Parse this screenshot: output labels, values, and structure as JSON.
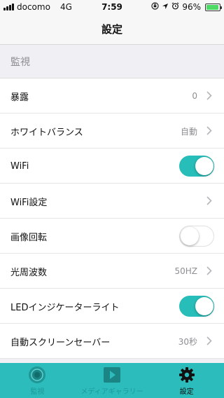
{
  "status_bar": {
    "carrier": "docomo",
    "network": "4G",
    "time": "7:59",
    "battery_percent": "96%",
    "battery_level": 0.96,
    "icons": [
      "signal-icon",
      "lock-rotation-icon",
      "location-icon",
      "alarm-icon",
      "battery-icon"
    ]
  },
  "nav": {
    "title": "設定"
  },
  "section": {
    "title": "監視"
  },
  "rows": [
    {
      "label": "暴露",
      "value": "0",
      "kind": "disclosure"
    },
    {
      "label": "ホワイトバランス",
      "value": "自動",
      "kind": "disclosure"
    },
    {
      "label": "WiFi",
      "kind": "toggle",
      "on": true
    },
    {
      "label": "WiFi設定",
      "kind": "disclosure"
    },
    {
      "label": "画像回転",
      "kind": "toggle",
      "on": false
    },
    {
      "label": "光周波数",
      "value": "50HZ",
      "kind": "disclosure"
    },
    {
      "label": "LEDインジケーターライト",
      "kind": "toggle",
      "on": true
    },
    {
      "label": "自動スクリーンセーバー",
      "value": "30秒",
      "kind": "disclosure"
    }
  ],
  "tabs": [
    {
      "label": "監視",
      "icon": "camera-lens-icon",
      "active": false
    },
    {
      "label": "メディアギャラリー",
      "icon": "play-icon",
      "active": false
    },
    {
      "label": "設定",
      "icon": "gear-icon",
      "active": true
    }
  ],
  "colors": {
    "accent": "#27bdb9",
    "tab_bar": "#2bbcbb",
    "secondary_text": "#8e8e93"
  }
}
